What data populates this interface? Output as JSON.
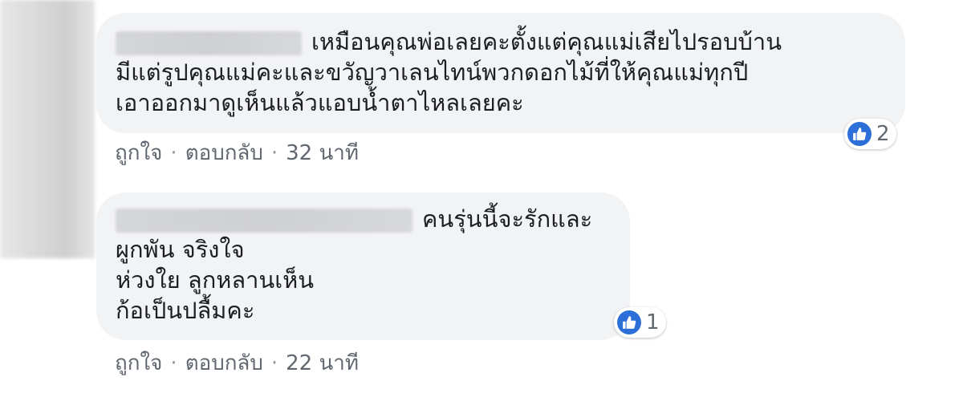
{
  "comments": [
    {
      "text_lines": [
        "เหมือนคุณพ่อเลยคะตั้งแต่คุณแม่เสียไปรอบบ้าน",
        "มีแต่รูปคุณแม่คะและขวัญวาเลนไทน์พวกดอกไม้ที่ให้คุณแม่ทุกปี",
        "เอาออกมาดูเห็นแล้วแอบน้ำตาไหลเลยคะ"
      ],
      "reaction_count": "2",
      "like_label": "ถูกใจ",
      "reply_label": "ตอบกลับ",
      "separator": "·",
      "timestamp": "32 นาที"
    },
    {
      "text_lines": [
        "คนรุ่นนี้จะรักและ",
        "ผูกพัน จริงใจ",
        "ห่วงใย ลูกหลานเห็น",
        "ก้อเป็นปลื้มคะ"
      ],
      "reaction_count": "1",
      "like_label": "ถูกใจ",
      "reply_label": "ตอบกลับ",
      "separator": "·",
      "timestamp": "22 นาที"
    }
  ],
  "icons": {
    "reaction": "like-thumbs-up-icon",
    "reaction_color": "#2d6fd9"
  }
}
